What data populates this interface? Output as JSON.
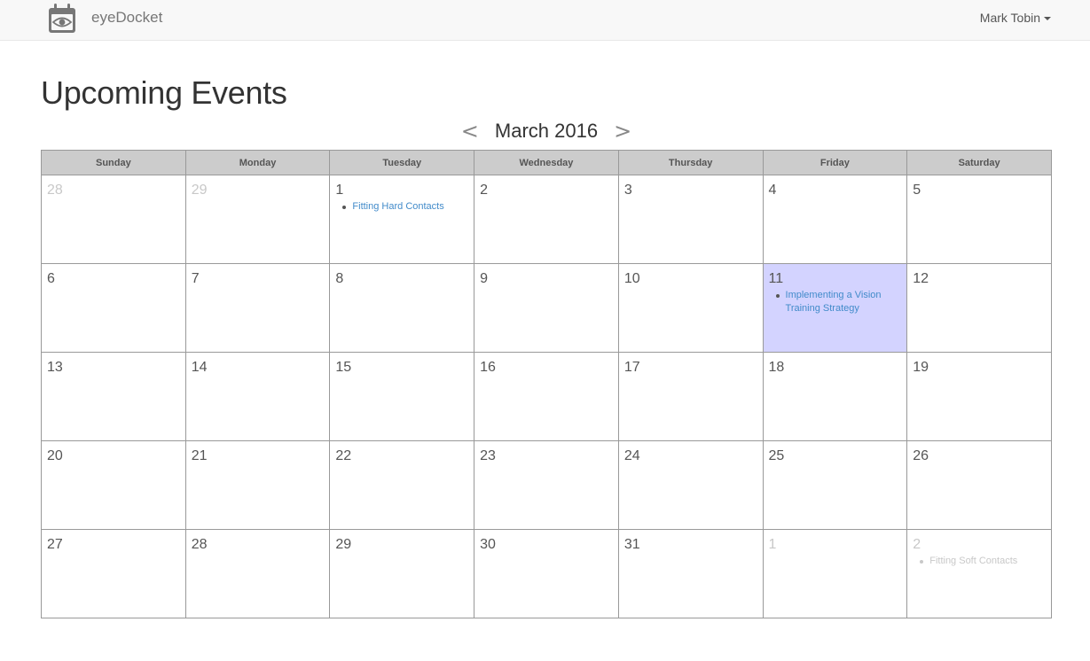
{
  "navbar": {
    "brand": "eyeDocket",
    "brand_icon": "calendar-eye-icon",
    "user_name": "Mark Tobin"
  },
  "page_title": "Upcoming Events",
  "calendar": {
    "month_label": "March 2016",
    "prev_symbol": "<",
    "next_symbol": ">",
    "weekdays": [
      "Sunday",
      "Monday",
      "Tuesday",
      "Wednesday",
      "Thursday",
      "Friday",
      "Saturday"
    ],
    "highlight_color": "#d3d3ff",
    "weeks": [
      [
        {
          "day": "28",
          "other_month": true,
          "events": []
        },
        {
          "day": "29",
          "other_month": true,
          "events": []
        },
        {
          "day": "1",
          "other_month": false,
          "events": [
            "Fitting Hard Contacts"
          ]
        },
        {
          "day": "2",
          "other_month": false,
          "events": []
        },
        {
          "day": "3",
          "other_month": false,
          "events": []
        },
        {
          "day": "4",
          "other_month": false,
          "events": []
        },
        {
          "day": "5",
          "other_month": false,
          "events": []
        }
      ],
      [
        {
          "day": "6",
          "other_month": false,
          "events": []
        },
        {
          "day": "7",
          "other_month": false,
          "events": []
        },
        {
          "day": "8",
          "other_month": false,
          "events": []
        },
        {
          "day": "9",
          "other_month": false,
          "events": []
        },
        {
          "day": "10",
          "other_month": false,
          "events": []
        },
        {
          "day": "11",
          "other_month": false,
          "today": true,
          "events": [
            "Implementing a Vision Training Strategy"
          ]
        },
        {
          "day": "12",
          "other_month": false,
          "events": []
        }
      ],
      [
        {
          "day": "13",
          "other_month": false,
          "events": []
        },
        {
          "day": "14",
          "other_month": false,
          "events": []
        },
        {
          "day": "15",
          "other_month": false,
          "events": []
        },
        {
          "day": "16",
          "other_month": false,
          "events": []
        },
        {
          "day": "17",
          "other_month": false,
          "events": []
        },
        {
          "day": "18",
          "other_month": false,
          "events": []
        },
        {
          "day": "19",
          "other_month": false,
          "events": []
        }
      ],
      [
        {
          "day": "20",
          "other_month": false,
          "events": []
        },
        {
          "day": "21",
          "other_month": false,
          "events": []
        },
        {
          "day": "22",
          "other_month": false,
          "events": []
        },
        {
          "day": "23",
          "other_month": false,
          "events": []
        },
        {
          "day": "24",
          "other_month": false,
          "events": []
        },
        {
          "day": "25",
          "other_month": false,
          "events": []
        },
        {
          "day": "26",
          "other_month": false,
          "events": []
        }
      ],
      [
        {
          "day": "27",
          "other_month": false,
          "events": []
        },
        {
          "day": "28",
          "other_month": false,
          "events": []
        },
        {
          "day": "29",
          "other_month": false,
          "events": []
        },
        {
          "day": "30",
          "other_month": false,
          "events": []
        },
        {
          "day": "31",
          "other_month": false,
          "events": []
        },
        {
          "day": "1",
          "other_month": true,
          "events": []
        },
        {
          "day": "2",
          "other_month": true,
          "events": [
            "Fitting Soft Contacts"
          ]
        }
      ]
    ]
  }
}
